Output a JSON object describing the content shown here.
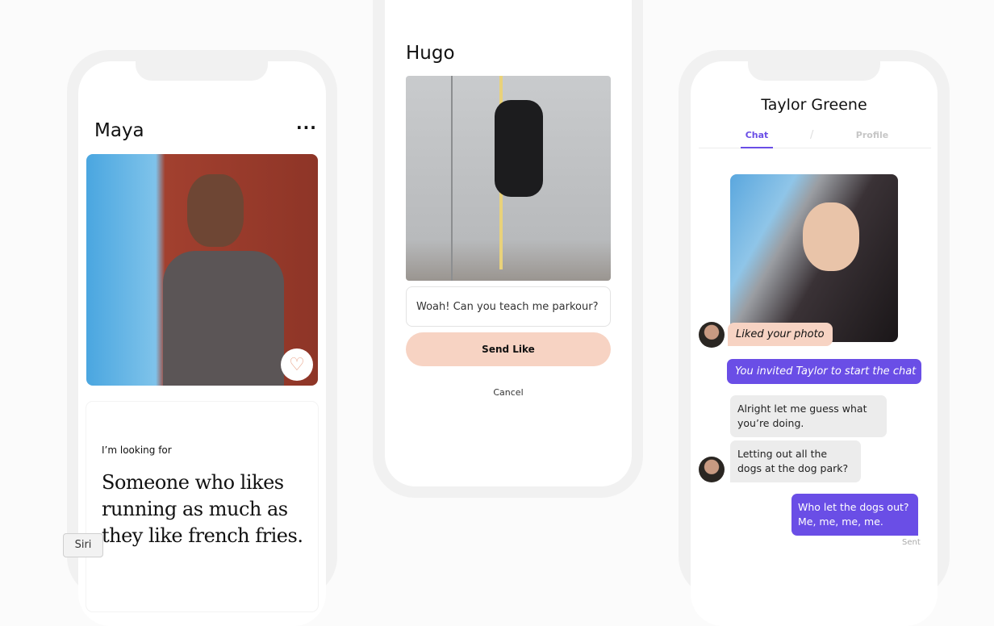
{
  "maya": {
    "name": "Maya",
    "more_icon": "ellipsis-icon",
    "like_icon": "heart-icon",
    "looking_for_label": "I’m looking for",
    "looking_for_text": "Someone who likes running as much as they like french fries."
  },
  "hugo": {
    "name": "Hugo",
    "comment_value": "Woah! Can you teach me parkour?",
    "send_label": "Send Like",
    "cancel_label": "Cancel"
  },
  "chat": {
    "title": "Taylor Greene",
    "tabs": [
      {
        "label": "Chat",
        "active": true
      },
      {
        "label": "Profile",
        "active": false
      }
    ],
    "tab_separator": "/",
    "liked_photo": "Liked your photo",
    "invited": "You invited Taylor to start the chat",
    "messages": [
      {
        "from": "them",
        "text": "Alright let me guess what you’re doing."
      },
      {
        "from": "them",
        "text": "Letting out all the dogs at the dog park?"
      },
      {
        "from": "me",
        "text": "Who let the dogs out? Me, me, me, me."
      }
    ],
    "status": "Sent"
  },
  "siri_label": "Siri",
  "colors": {
    "accent": "#6a4ee6",
    "peach": "#f7d3c3",
    "bubble_gray": "#ececec"
  }
}
